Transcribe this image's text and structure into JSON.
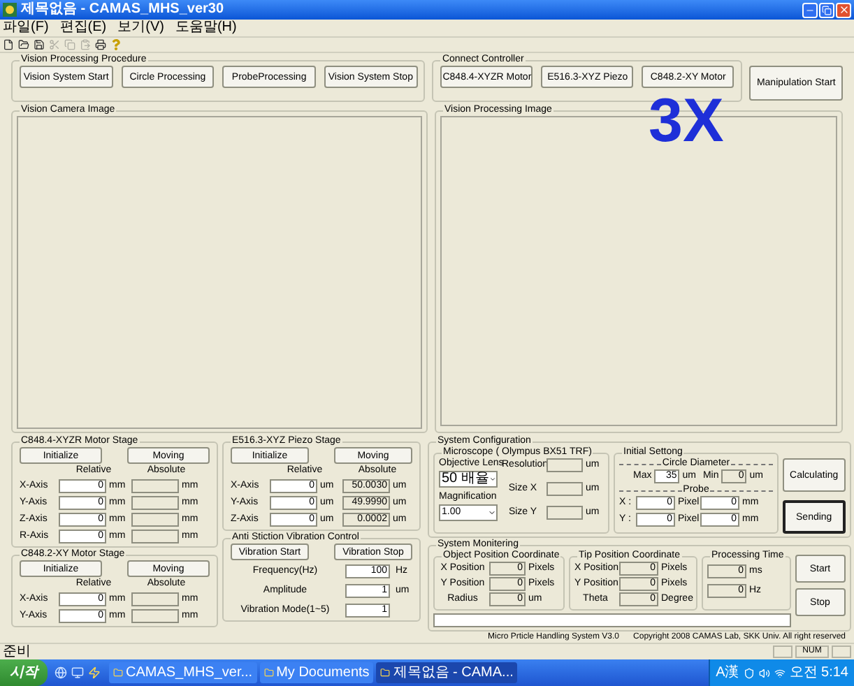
{
  "window": {
    "title": "제목없음 - CAMAS_MHS_ver30"
  },
  "menu": [
    "파일(F)",
    "편집(E)",
    "보기(V)",
    "도움말(H)"
  ],
  "toolbar": [
    {
      "kind": "new",
      "disabled": false
    },
    {
      "kind": "open",
      "disabled": false
    },
    {
      "kind": "save",
      "disabled": false
    },
    {
      "kind": "cut",
      "disabled": true
    },
    {
      "kind": "copy",
      "disabled": true
    },
    {
      "kind": "paste",
      "disabled": true
    },
    {
      "kind": "print",
      "disabled": false
    },
    {
      "kind": "about",
      "disabled": false
    }
  ],
  "procedure": {
    "title": "Vision Processing Procedure",
    "buttons": [
      "Vision System Start",
      "Circle Processing",
      "ProbeProcessing",
      "Vision System Stop"
    ]
  },
  "controller": {
    "title": "Connect Controller",
    "buttons": [
      "C848.4-XYZR Motor",
      "E516.3-XYZ Piezo",
      "C848.2-XY Motor"
    ]
  },
  "manipulation_button": "Manipulation Start",
  "camera_image": {
    "title": "Vision Camera Image"
  },
  "processing_image": {
    "title": "Vision Processing Image",
    "overlay": "3X"
  },
  "xyzr_stage": {
    "title": "C848.4-XYZR Motor Stage",
    "buttons": [
      "Initialize",
      "Moving"
    ],
    "headers": [
      "Relative",
      "Absolute"
    ],
    "rows": [
      {
        "axis": "X-Axis",
        "relative": "0",
        "relative_unit": "mm",
        "absolute_unit": "mm"
      },
      {
        "axis": "Y-Axis",
        "relative": "0",
        "relative_unit": "mm",
        "absolute_unit": "mm"
      },
      {
        "axis": "Z-Axis",
        "relative": "0",
        "relative_unit": "mm",
        "absolute_unit": "mm"
      },
      {
        "axis": "R-Axis",
        "relative": "0",
        "relative_unit": "mm",
        "absolute_unit": "mm"
      }
    ]
  },
  "xy_stage": {
    "title": "C848.2-XY Motor Stage",
    "buttons": [
      "Initialize",
      "Moving"
    ],
    "headers": [
      "Relative",
      "Absolute"
    ],
    "rows": [
      {
        "axis": "X-Axis",
        "relative": "0",
        "relative_unit": "mm",
        "absolute_unit": "mm"
      },
      {
        "axis": "Y-Axis",
        "relative": "0",
        "relative_unit": "mm",
        "absolute_unit": "mm"
      }
    ]
  },
  "piezo_stage": {
    "title": "E516.3-XYZ Piezo Stage",
    "buttons": [
      "Initialize",
      "Moving"
    ],
    "headers": [
      "Relative",
      "Absolute"
    ],
    "rows": [
      {
        "axis": "X-Axis",
        "relative": "0",
        "relative_unit": "um",
        "absolute": "50.0030",
        "absolute_unit": "um"
      },
      {
        "axis": "Y-Axis",
        "relative": "0",
        "relative_unit": "um",
        "absolute": "49.9990",
        "absolute_unit": "um"
      },
      {
        "axis": "Z-Axis",
        "relative": "0",
        "relative_unit": "um",
        "absolute": "0.0002",
        "absolute_unit": "um"
      }
    ]
  },
  "vibration_control": {
    "title": "Anti Stiction Vibration Control",
    "buttons": [
      "Vibration Start",
      "Vibration Stop"
    ],
    "rows": [
      {
        "label": "Frequency(Hz)",
        "value": "100",
        "unit": "Hz"
      },
      {
        "label": "Amplitude",
        "value": "1",
        "unit": "um"
      },
      {
        "label": "Vibration Mode(1~5)",
        "value": "1"
      }
    ]
  },
  "system_configuration": {
    "title": "System Configuration",
    "microscope": {
      "title": "Microscope ( Olympus BX51 TRF)",
      "lens_label": "Objective Lens",
      "lens_value": "50 배율",
      "magnification_label": "Magnification",
      "magnification_value": "1.00",
      "fields": [
        {
          "label": "Resolution",
          "unit": "um"
        },
        {
          "label": "Size X",
          "unit": "um"
        },
        {
          "label": "Size Y",
          "unit": "um"
        }
      ]
    },
    "initial_setting": {
      "title": "Initial Settong",
      "circle_title": "Circle Diameter",
      "max_label": "Max",
      "max_value": "35",
      "max_unit": "um",
      "min_label": "Min",
      "min_value": "0",
      "min_unit": "um",
      "probe_title": "Probe",
      "probe_rows": [
        {
          "label": "X :",
          "pixel": "0",
          "pixel_unit": "Pixel",
          "mm": "0",
          "mm_unit": "mm"
        },
        {
          "label": "Y :",
          "pixel": "0",
          "pixel_unit": "Pixel",
          "mm": "0",
          "mm_unit": "mm"
        }
      ]
    },
    "buttons": [
      {
        "label": "Calculating",
        "focused": false
      },
      {
        "label": "Sending",
        "focused": true
      }
    ]
  },
  "system_monitoring": {
    "title": "System Monitering",
    "object": {
      "title": "Object Position Coordinate",
      "rows": [
        {
          "label": "X Position",
          "value": "0",
          "unit": "Pixels"
        },
        {
          "label": "Y Position",
          "value": "0",
          "unit": "Pixels"
        },
        {
          "label": "Radius",
          "value": "0",
          "unit": "um"
        }
      ]
    },
    "tip": {
      "title": "Tip Position Coordinate",
      "rows": [
        {
          "label": "X Position",
          "value": "0",
          "unit": "Pixels"
        },
        {
          "label": "Y Position",
          "value": "0",
          "unit": "Pixels"
        },
        {
          "label": "Theta",
          "value": "0",
          "unit": "Degree"
        }
      ]
    },
    "processing": {
      "title": "Processing Time",
      "rows": [
        {
          "value": "0",
          "unit": "ms"
        },
        {
          "value": "0",
          "unit": "Hz"
        }
      ]
    },
    "buttons": [
      "Start",
      "Stop"
    ]
  },
  "footer": {
    "version": "Micro Prticle Handling System V3.0",
    "copyright": "Copyright 2008 CAMAS Lab, SKK Univ. All right reserved"
  },
  "status_bar": {
    "text": "준비",
    "indicators": [
      "NUM"
    ]
  },
  "taskbar": {
    "start": "시작",
    "tasks": [
      {
        "label": "CAMAS_MHS_ver...",
        "selected": false
      },
      {
        "label": "My Documents",
        "selected": false
      },
      {
        "label": "제목없음 - CAMA...",
        "selected": true
      }
    ],
    "ime": "A漢",
    "clock": "오전 5:14"
  }
}
